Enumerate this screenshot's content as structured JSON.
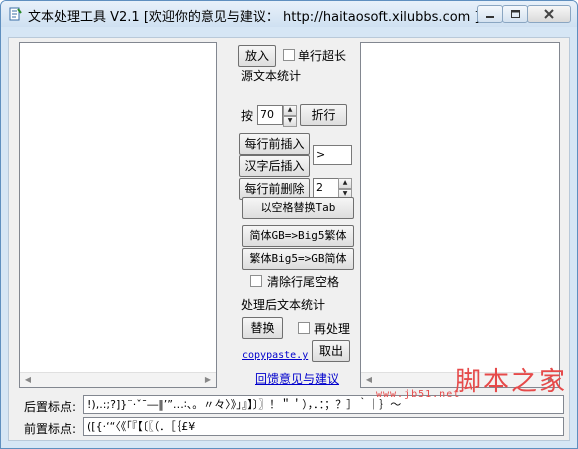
{
  "window": {
    "title": "文本处理工具 V2.1 [欢迎你的意见与建议： http://haitaosoft.xilubbs.com ]"
  },
  "controls": {
    "put_in": "放入",
    "single_line_long": "单行超长",
    "source_stats": "源文本统计",
    "by_label": "按",
    "wrap_value": "70",
    "wrap_button": "折行",
    "prefix_insert": "每行前插入",
    "hanzi_suffix_insert": "汉字后插入",
    "insert_text": ">",
    "delete_prefix": "每行前删除",
    "delete_count": "2",
    "space_to_tab": "以空格替换Tab",
    "gb_to_big5": "简体GB=>Big5繁体",
    "big5_to_gb": "繁体Big5=>GB简体",
    "clear_trailing": "清除行尾空格",
    "processed_stats": "处理后文本统计",
    "replace": "替换",
    "reprocess": "再处理",
    "copypaste": "copypaste.y",
    "take_out": "取出",
    "feedback": "回馈意见与建议"
  },
  "bottom": {
    "post_punct_label": "后置标点:",
    "post_punct_value": "!),.:;?]}¨·ˇˉ―‖’”…∶、。〃々〉》」』】〕〗！＂＇），．：；？］｀｜｝～",
    "pre_punct_label": "前置标点:",
    "pre_punct_value": "([{·‘“〈《「『【〔〖（．［｛£¥"
  },
  "watermark": {
    "text": "脚本之家",
    "sub": "www.jb51.net"
  }
}
